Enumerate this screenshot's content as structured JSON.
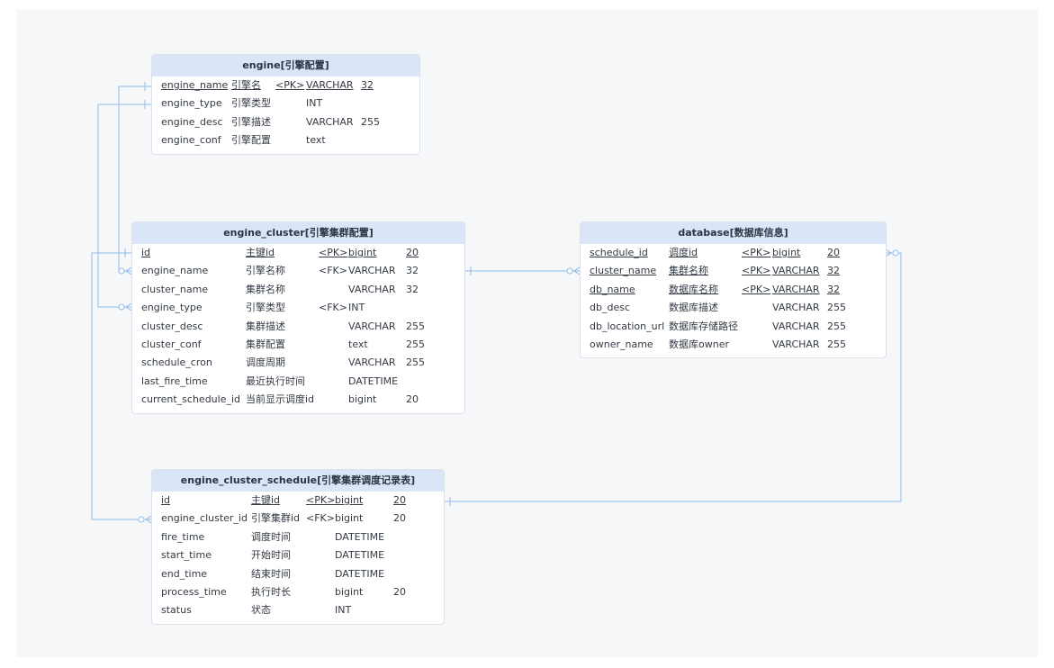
{
  "tables": {
    "engine": {
      "title": "engine[引擎配置]",
      "rows": [
        {
          "name": "engine_name",
          "comment": "引擎名",
          "key": "<PK>",
          "type": "VARCHAR",
          "length": "32",
          "pk": true
        },
        {
          "name": "engine_type",
          "comment": "引擎类型",
          "key": "",
          "type": "INT",
          "length": "",
          "pk": false
        },
        {
          "name": "engine_desc",
          "comment": "引擎描述",
          "key": "",
          "type": "VARCHAR",
          "length": "255",
          "pk": false
        },
        {
          "name": "engine_conf",
          "comment": "引擎配置",
          "key": "",
          "type": "text",
          "length": "",
          "pk": false
        }
      ]
    },
    "engine_cluster": {
      "title": "engine_cluster[引擎集群配置]",
      "rows": [
        {
          "name": "id",
          "comment": "主键id",
          "key": "<PK>",
          "type": "bigint",
          "length": "20",
          "pk": true
        },
        {
          "name": "engine_name",
          "comment": "引擎名称",
          "key": "<FK>",
          "type": "VARCHAR",
          "length": "32",
          "pk": false
        },
        {
          "name": "cluster_name",
          "comment": "集群名称",
          "key": "",
          "type": "VARCHAR",
          "length": "32",
          "pk": false
        },
        {
          "name": "engine_type",
          "comment": "引擎类型",
          "key": "<FK>",
          "type": "INT",
          "length": "",
          "pk": false
        },
        {
          "name": "cluster_desc",
          "comment": "集群描述",
          "key": "",
          "type": "VARCHAR",
          "length": "255",
          "pk": false
        },
        {
          "name": "cluster_conf",
          "comment": "集群配置",
          "key": "",
          "type": "text",
          "length": "255",
          "pk": false
        },
        {
          "name": "schedule_cron",
          "comment": "调度周期",
          "key": "",
          "type": "VARCHAR",
          "length": "255",
          "pk": false
        },
        {
          "name": "last_fire_time",
          "comment": "最近执行时间",
          "key": "",
          "type": "DATETIME",
          "length": "",
          "pk": false
        },
        {
          "name": "current_schedule_id",
          "comment": "当前显示调度id",
          "key": "",
          "type": "bigint",
          "length": "20",
          "pk": false
        }
      ]
    },
    "database": {
      "title": "database[数据库信息]",
      "rows": [
        {
          "name": "schedule_id",
          "comment": "调度id",
          "key": "<PK>",
          "type": "bigint",
          "length": "20",
          "pk": true
        },
        {
          "name": "cluster_name",
          "comment": "集群名称",
          "key": "<PK>",
          "type": "VARCHAR",
          "length": "32",
          "pk": true
        },
        {
          "name": "db_name",
          "comment": "数据库名称",
          "key": "<PK>",
          "type": "VARCHAR",
          "length": "32",
          "pk": true
        },
        {
          "name": "db_desc",
          "comment": "数据库描述",
          "key": "",
          "type": "VARCHAR",
          "length": "255",
          "pk": false
        },
        {
          "name": "db_location_url",
          "comment": "数据库存储路径",
          "key": "",
          "type": "VARCHAR",
          "length": "255",
          "pk": false
        },
        {
          "name": "owner_name",
          "comment": "数据库owner",
          "key": "",
          "type": "VARCHAR",
          "length": "255",
          "pk": false
        }
      ]
    },
    "engine_cluster_schedule": {
      "title": "engine_cluster_schedule[引擎集群调度记录表]",
      "rows": [
        {
          "name": "id",
          "comment": "主键id",
          "key": "<PK>",
          "type": "bigint",
          "length": "20",
          "pk": true
        },
        {
          "name": "engine_cluster_id",
          "comment": "引擎集群id",
          "key": "<FK>",
          "type": "bigint",
          "length": "20",
          "pk": false
        },
        {
          "name": "fire_time",
          "comment": "调度时间",
          "key": "",
          "type": "DATETIME",
          "length": "",
          "pk": false
        },
        {
          "name": "start_time",
          "comment": "开始时间",
          "key": "",
          "type": "DATETIME",
          "length": "",
          "pk": false
        },
        {
          "name": "end_time",
          "comment": "结束时间",
          "key": "",
          "type": "DATETIME",
          "length": "",
          "pk": false
        },
        {
          "name": "process_time",
          "comment": "执行时长",
          "key": "",
          "type": "bigint",
          "length": "20",
          "pk": false
        },
        {
          "name": "status",
          "comment": "状态",
          "key": "",
          "type": "INT",
          "length": "",
          "pk": false
        }
      ]
    }
  },
  "colors": {
    "header_bg": "#dbe5f8",
    "connector": "#8fbbe8",
    "canvas_bg": "#f6f7f9"
  }
}
